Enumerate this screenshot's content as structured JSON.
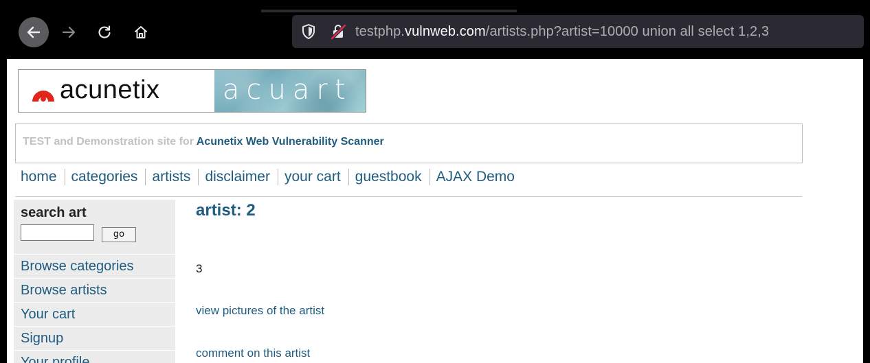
{
  "browser": {
    "url_prefix": "testphp.",
    "url_host": "vulnweb.com",
    "url_path": "/artists.php?artist=10000 union all select 1,2,3",
    "icons": [
      "back-arrow-icon",
      "forward-arrow-icon",
      "reload-icon",
      "home-icon",
      "shield-icon",
      "insecure-lock-icon"
    ]
  },
  "header": {
    "logo_text": "acunetix",
    "logo_alt_text": "acuart",
    "tagline_prefix": "TEST and Demonstration site for",
    "tagline_product": "Acunetix Web Vulnerability Scanner"
  },
  "topnav": {
    "items": [
      "home",
      "categories",
      "artists",
      "disclaimer",
      "your cart",
      "guestbook",
      "AJAX Demo"
    ]
  },
  "sidebar": {
    "search_title": "search art",
    "search_value": "",
    "go_label": "go",
    "items": [
      "Browse categories",
      "Browse artists",
      "Your cart",
      "Signup",
      "Your profile"
    ]
  },
  "content": {
    "title": "artist: 2",
    "value": "3",
    "link_pictures": "view pictures of the artist",
    "link_comment": "comment on this artist"
  },
  "colors": {
    "link": "#1f5c7f",
    "chrome_bg": "#000000",
    "urlbar_bg": "#2b2a33",
    "insecure_slash": "#e22850"
  }
}
